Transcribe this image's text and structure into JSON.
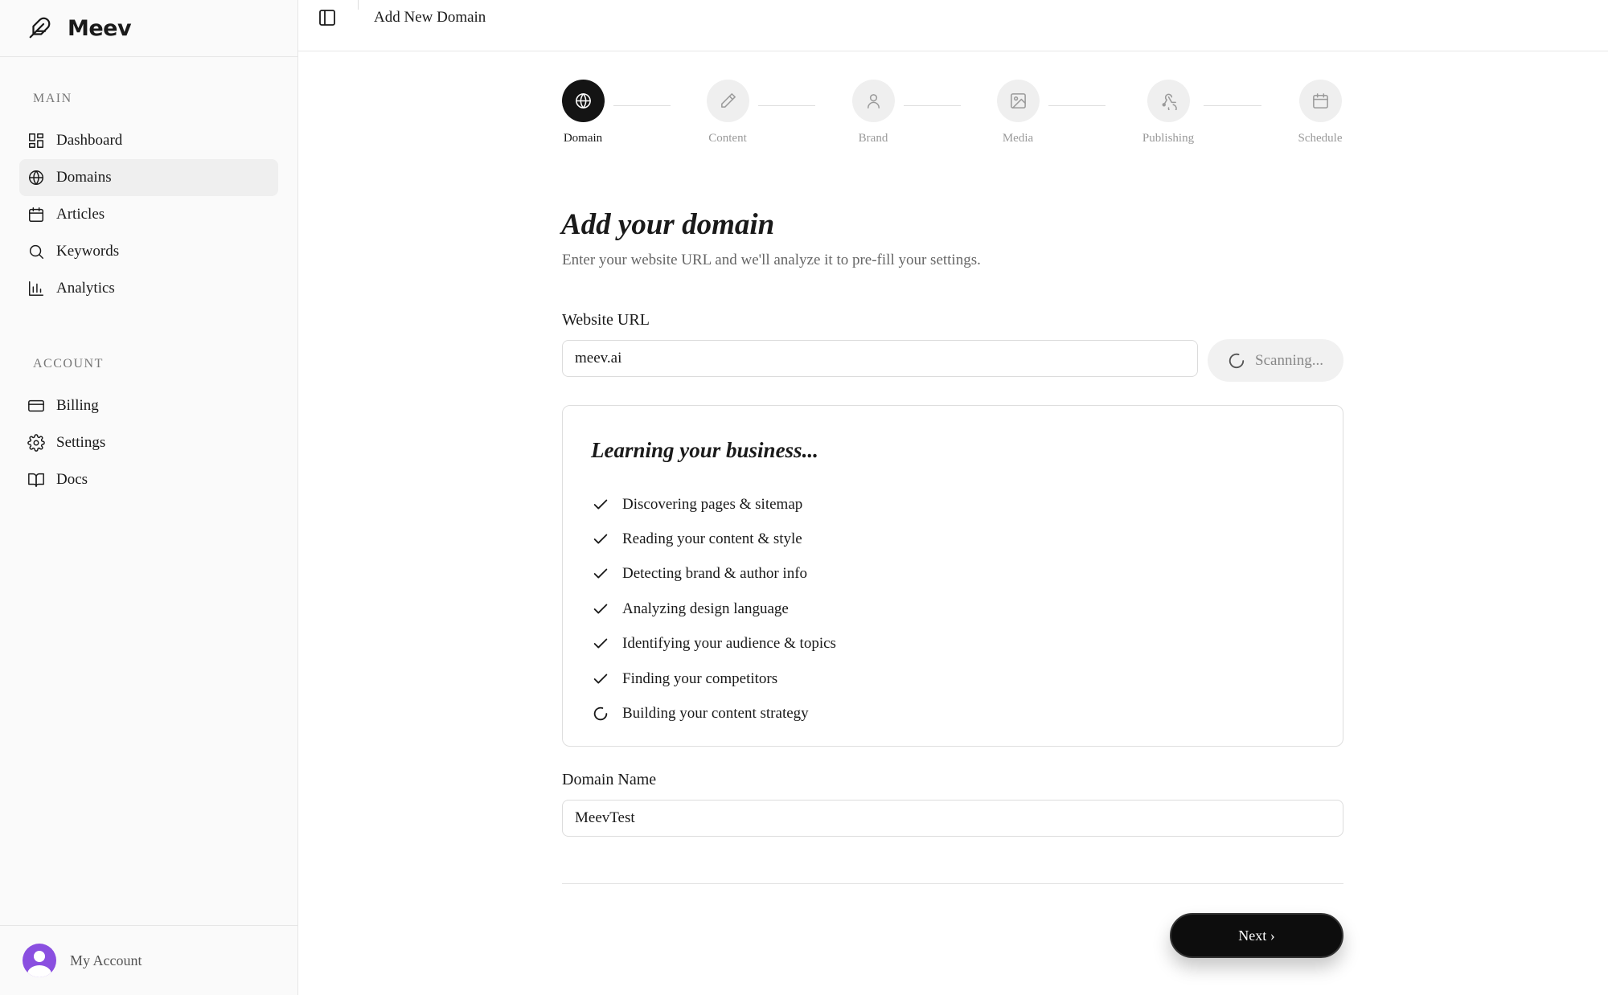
{
  "app": {
    "name": "Meev"
  },
  "sidebar": {
    "sections": [
      {
        "title": "MAIN",
        "items": [
          {
            "label": "Dashboard",
            "icon": "dashboard-icon",
            "active": false
          },
          {
            "label": "Domains",
            "icon": "globe-icon",
            "active": true
          },
          {
            "label": "Articles",
            "icon": "calendar-icon",
            "active": false
          },
          {
            "label": "Keywords",
            "icon": "search-icon",
            "active": false
          },
          {
            "label": "Analytics",
            "icon": "bar-chart-icon",
            "active": false
          }
        ]
      },
      {
        "title": "ACCOUNT",
        "items": [
          {
            "label": "Billing",
            "icon": "credit-card-icon",
            "active": false
          },
          {
            "label": "Settings",
            "icon": "gear-icon",
            "active": false
          },
          {
            "label": "Docs",
            "icon": "book-icon",
            "active": false
          }
        ]
      }
    ],
    "footer": {
      "label": "My Account",
      "avatar_color": "#8a4fe0"
    }
  },
  "topbar": {
    "title": "Add New Domain"
  },
  "stepper": {
    "steps": [
      {
        "label": "Domain",
        "icon": "globe-icon",
        "active": true
      },
      {
        "label": "Content",
        "icon": "pencil-icon",
        "active": false
      },
      {
        "label": "Brand",
        "icon": "user-icon",
        "active": false
      },
      {
        "label": "Media",
        "icon": "image-icon",
        "active": false
      },
      {
        "label": "Publishing",
        "icon": "webhook-icon",
        "active": false
      },
      {
        "label": "Schedule",
        "icon": "calendar-icon",
        "active": false
      }
    ]
  },
  "form": {
    "heading": "Add your domain",
    "subtitle": "Enter your website URL and we'll analyze it to pre-fill your settings.",
    "url_label": "Website URL",
    "url_value": "meev.ai",
    "scan_button": "Scanning...",
    "learning": {
      "title": "Learning your business...",
      "tasks": [
        {
          "label": "Discovering pages & sitemap",
          "status": "done"
        },
        {
          "label": "Reading your content & style",
          "status": "done"
        },
        {
          "label": "Detecting brand & author info",
          "status": "done"
        },
        {
          "label": "Analyzing design language",
          "status": "done"
        },
        {
          "label": "Identifying your audience & topics",
          "status": "done"
        },
        {
          "label": "Finding your competitors",
          "status": "done"
        },
        {
          "label": "Building your content strategy",
          "status": "in-progress"
        }
      ]
    },
    "name_label": "Domain Name",
    "name_value": "MeevTest",
    "next_button": "Next ›"
  },
  "colors": {
    "accent": "#141414",
    "sidebar_bg": "#fafafa",
    "active_nav": "#efefef"
  }
}
